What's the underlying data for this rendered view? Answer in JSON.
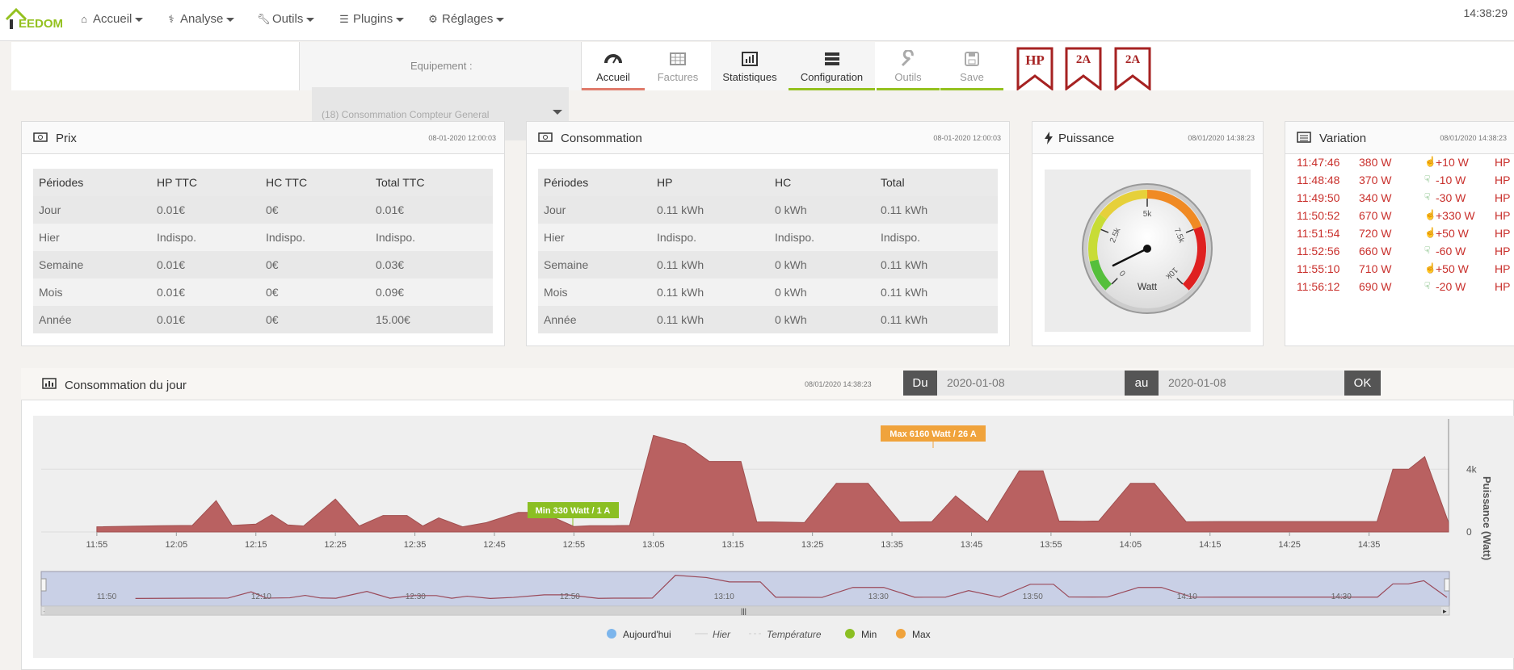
{
  "navbar": {
    "logo_text": "EEDOM",
    "items": [
      {
        "label": "Accueil",
        "icon": "home-icon"
      },
      {
        "label": "Analyse",
        "icon": "stethoscope-icon"
      },
      {
        "label": "Outils",
        "icon": "wrench-icon"
      },
      {
        "label": "Plugins",
        "icon": "list-icon"
      },
      {
        "label": "Réglages",
        "icon": "gear-icon"
      }
    ],
    "clock": "14:38:29"
  },
  "equipment": {
    "label": "Equipement :",
    "selected": "(18) Consommation Compteur General"
  },
  "tabs": [
    {
      "label": "Accueil",
      "icon": "dashboard-icon"
    },
    {
      "label": "Factures",
      "icon": "table-icon"
    },
    {
      "label": "Statistiques",
      "icon": "bar-chart-icon"
    },
    {
      "label": "Configuration",
      "icon": "server-icon"
    },
    {
      "label": "Outils",
      "icon": "wrench-icon"
    },
    {
      "label": "Save",
      "icon": "save-icon"
    }
  ],
  "flags": [
    "HP",
    "2A",
    "2A"
  ],
  "prix": {
    "title": "Prix",
    "date": "08-01-2020 12:00:03",
    "headers": [
      "Périodes",
      "HP TTC",
      "HC TTC",
      "Total TTC"
    ],
    "rows": [
      [
        "Jour",
        "0.01€",
        "0€",
        "0.01€"
      ],
      [
        "Hier",
        "Indispo.",
        "Indispo.",
        "Indispo."
      ],
      [
        "Semaine",
        "0.01€",
        "0€",
        "0.03€"
      ],
      [
        "Mois",
        "0.01€",
        "0€",
        "0.09€"
      ],
      [
        "Année",
        "0.01€",
        "0€",
        "15.00€"
      ]
    ]
  },
  "consommation": {
    "title": "Consommation",
    "date": "08-01-2020 12:00:03",
    "headers": [
      "Périodes",
      "HP",
      "HC",
      "Total"
    ],
    "rows": [
      [
        "Jour",
        "0.11 kWh",
        "0 kWh",
        "0.11 kWh"
      ],
      [
        "Hier",
        "Indispo.",
        "Indispo.",
        "Indispo."
      ],
      [
        "Semaine",
        "0.11 kWh",
        "0 kWh",
        "0.11 kWh"
      ],
      [
        "Mois",
        "0.11 kWh",
        "0 kWh",
        "0.11 kWh"
      ],
      [
        "Année",
        "0.11 kWh",
        "0 kWh",
        "0.11 kWh"
      ]
    ]
  },
  "puissance": {
    "title": "Puissance",
    "date": "08/01/2020 14:38:23",
    "gauge_unit": "Watt",
    "gauge_ticks": [
      "0",
      "2.5k",
      "5k",
      "7.5k",
      "10k"
    ],
    "gauge_value": 690,
    "gauge_max": 10000
  },
  "variation": {
    "title": "Variation",
    "date": "08/01/2020 14:38:23",
    "rows": [
      {
        "time": "11:47:46",
        "power": "380 W",
        "delta": "+10 W",
        "tarif": "HP",
        "dir": "up"
      },
      {
        "time": "11:48:48",
        "power": "370 W",
        "delta": "-10 W",
        "tarif": "HP",
        "dir": "down"
      },
      {
        "time": "11:49:50",
        "power": "340 W",
        "delta": "-30 W",
        "tarif": "HP",
        "dir": "down"
      },
      {
        "time": "11:50:52",
        "power": "670 W",
        "delta": "+330 W",
        "tarif": "HP",
        "dir": "up"
      },
      {
        "time": "11:51:54",
        "power": "720 W",
        "delta": "+50 W",
        "tarif": "HP",
        "dir": "up"
      },
      {
        "time": "11:52:56",
        "power": "660 W",
        "delta": "-60 W",
        "tarif": "HP",
        "dir": "down"
      },
      {
        "time": "11:55:10",
        "power": "710 W",
        "delta": "+50 W",
        "tarif": "HP",
        "dir": "up"
      },
      {
        "time": "11:56:12",
        "power": "690 W",
        "delta": "-20 W",
        "tarif": "HP",
        "dir": "down"
      }
    ]
  },
  "jour": {
    "title": "Consommation du jour",
    "date": "08/01/2020 14:38:23",
    "du_label": "Du",
    "du_value": "2020-01-08",
    "au_label": "au",
    "au_value": "2020-01-08",
    "ok_label": "OK"
  },
  "chart_data": {
    "type": "area",
    "ylabel": "Puissance (Watt)",
    "yticks": [
      "0",
      "4k"
    ],
    "ylim": [
      0,
      7000
    ],
    "xticks": [
      "11:55",
      "12:05",
      "12:15",
      "12:25",
      "12:35",
      "12:45",
      "12:55",
      "13:05",
      "13:15",
      "13:25",
      "13:35",
      "13:45",
      "13:55",
      "14:05",
      "14:15",
      "14:25",
      "14:35"
    ],
    "navigator_ticks": [
      "11:50",
      "12:10",
      "12:30",
      "12:50",
      "13:10",
      "13:30",
      "13:50",
      "14:10",
      "14:30"
    ],
    "annotations": {
      "max": "Max 6160 Watt / 26 A",
      "min": "Min 330 Watt / 1 A"
    },
    "legend": [
      "Aujourd'hui",
      "Hier",
      "Température",
      "Min",
      "Max"
    ],
    "x_minutes": [
      0,
      8,
      12,
      15,
      17,
      20,
      22,
      24,
      26,
      30,
      33,
      36,
      39,
      41,
      43,
      46,
      49,
      53,
      56,
      60,
      62,
      65,
      67,
      70,
      74,
      77,
      81,
      83,
      85,
      89,
      93,
      97,
      101,
      105,
      108,
      112,
      116,
      119,
      121,
      124,
      126,
      130,
      133,
      137,
      141,
      144,
      148,
      152,
      156,
      159,
      161,
      163,
      165,
      167,
      170
    ],
    "values": [
      330,
      400,
      420,
      2000,
      420,
      500,
      1100,
      450,
      380,
      2100,
      380,
      1050,
      1050,
      380,
      900,
      330,
      600,
      1250,
      1250,
      350,
      400,
      400,
      420,
      6160,
      5600,
      4500,
      4500,
      640,
      640,
      600,
      3100,
      3100,
      640,
      650,
      2300,
      650,
      3900,
      3900,
      700,
      680,
      700,
      3100,
      3100,
      650,
      660,
      660,
      660,
      660,
      660,
      660,
      660,
      4000,
      4000,
      4800,
      600
    ],
    "colors": {
      "area": "#b96161",
      "min_badge": "#8bbf23",
      "max_badge": "#f0a33c"
    }
  }
}
